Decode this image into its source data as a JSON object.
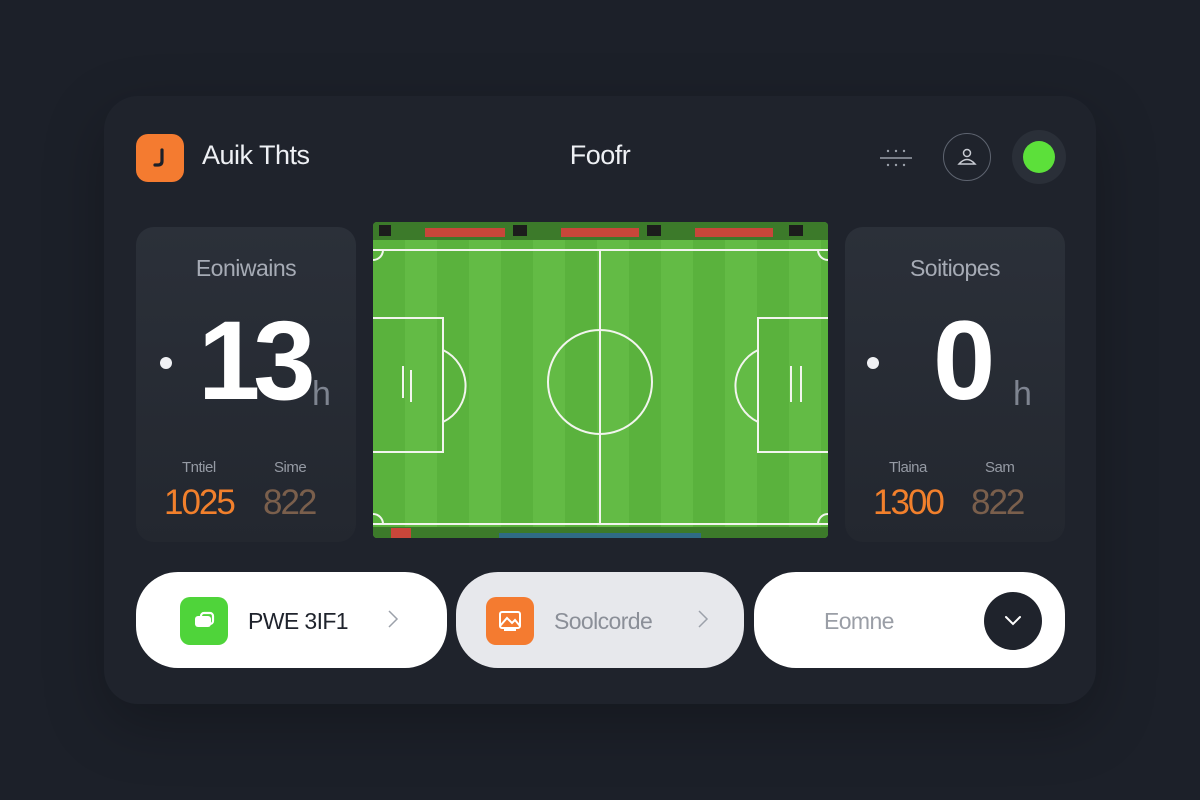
{
  "header": {
    "app_title": "Auik Thts",
    "center_title": "Foofr",
    "icons": {
      "logo": "app-logo-icon",
      "menu": "menu-icon",
      "user": "user-icon",
      "status": "status-dot"
    }
  },
  "left_panel": {
    "title": "Eoniwains",
    "value": "13",
    "unit": "h",
    "stats": [
      {
        "label": "Tntiel",
        "value": "1025"
      },
      {
        "label": "Sime",
        "value": "822"
      }
    ]
  },
  "right_panel": {
    "title": "Soitiopes",
    "value": "0",
    "unit": "h",
    "stats": [
      {
        "label": "Tlaina",
        "value": "1300"
      },
      {
        "label": "Sam",
        "value": "822"
      }
    ]
  },
  "buttons": [
    {
      "label": "PWE 3IF1",
      "icon": "camera-icon"
    },
    {
      "label": "Soolcorde",
      "icon": "image-icon"
    },
    {
      "label": "Eomne",
      "icon": "chevron-down-icon"
    }
  ],
  "colors": {
    "background": "#1c2029",
    "accent_orange": "#f47b30",
    "accent_green": "#5ce03a",
    "pitch_green": "#5bb33e"
  }
}
